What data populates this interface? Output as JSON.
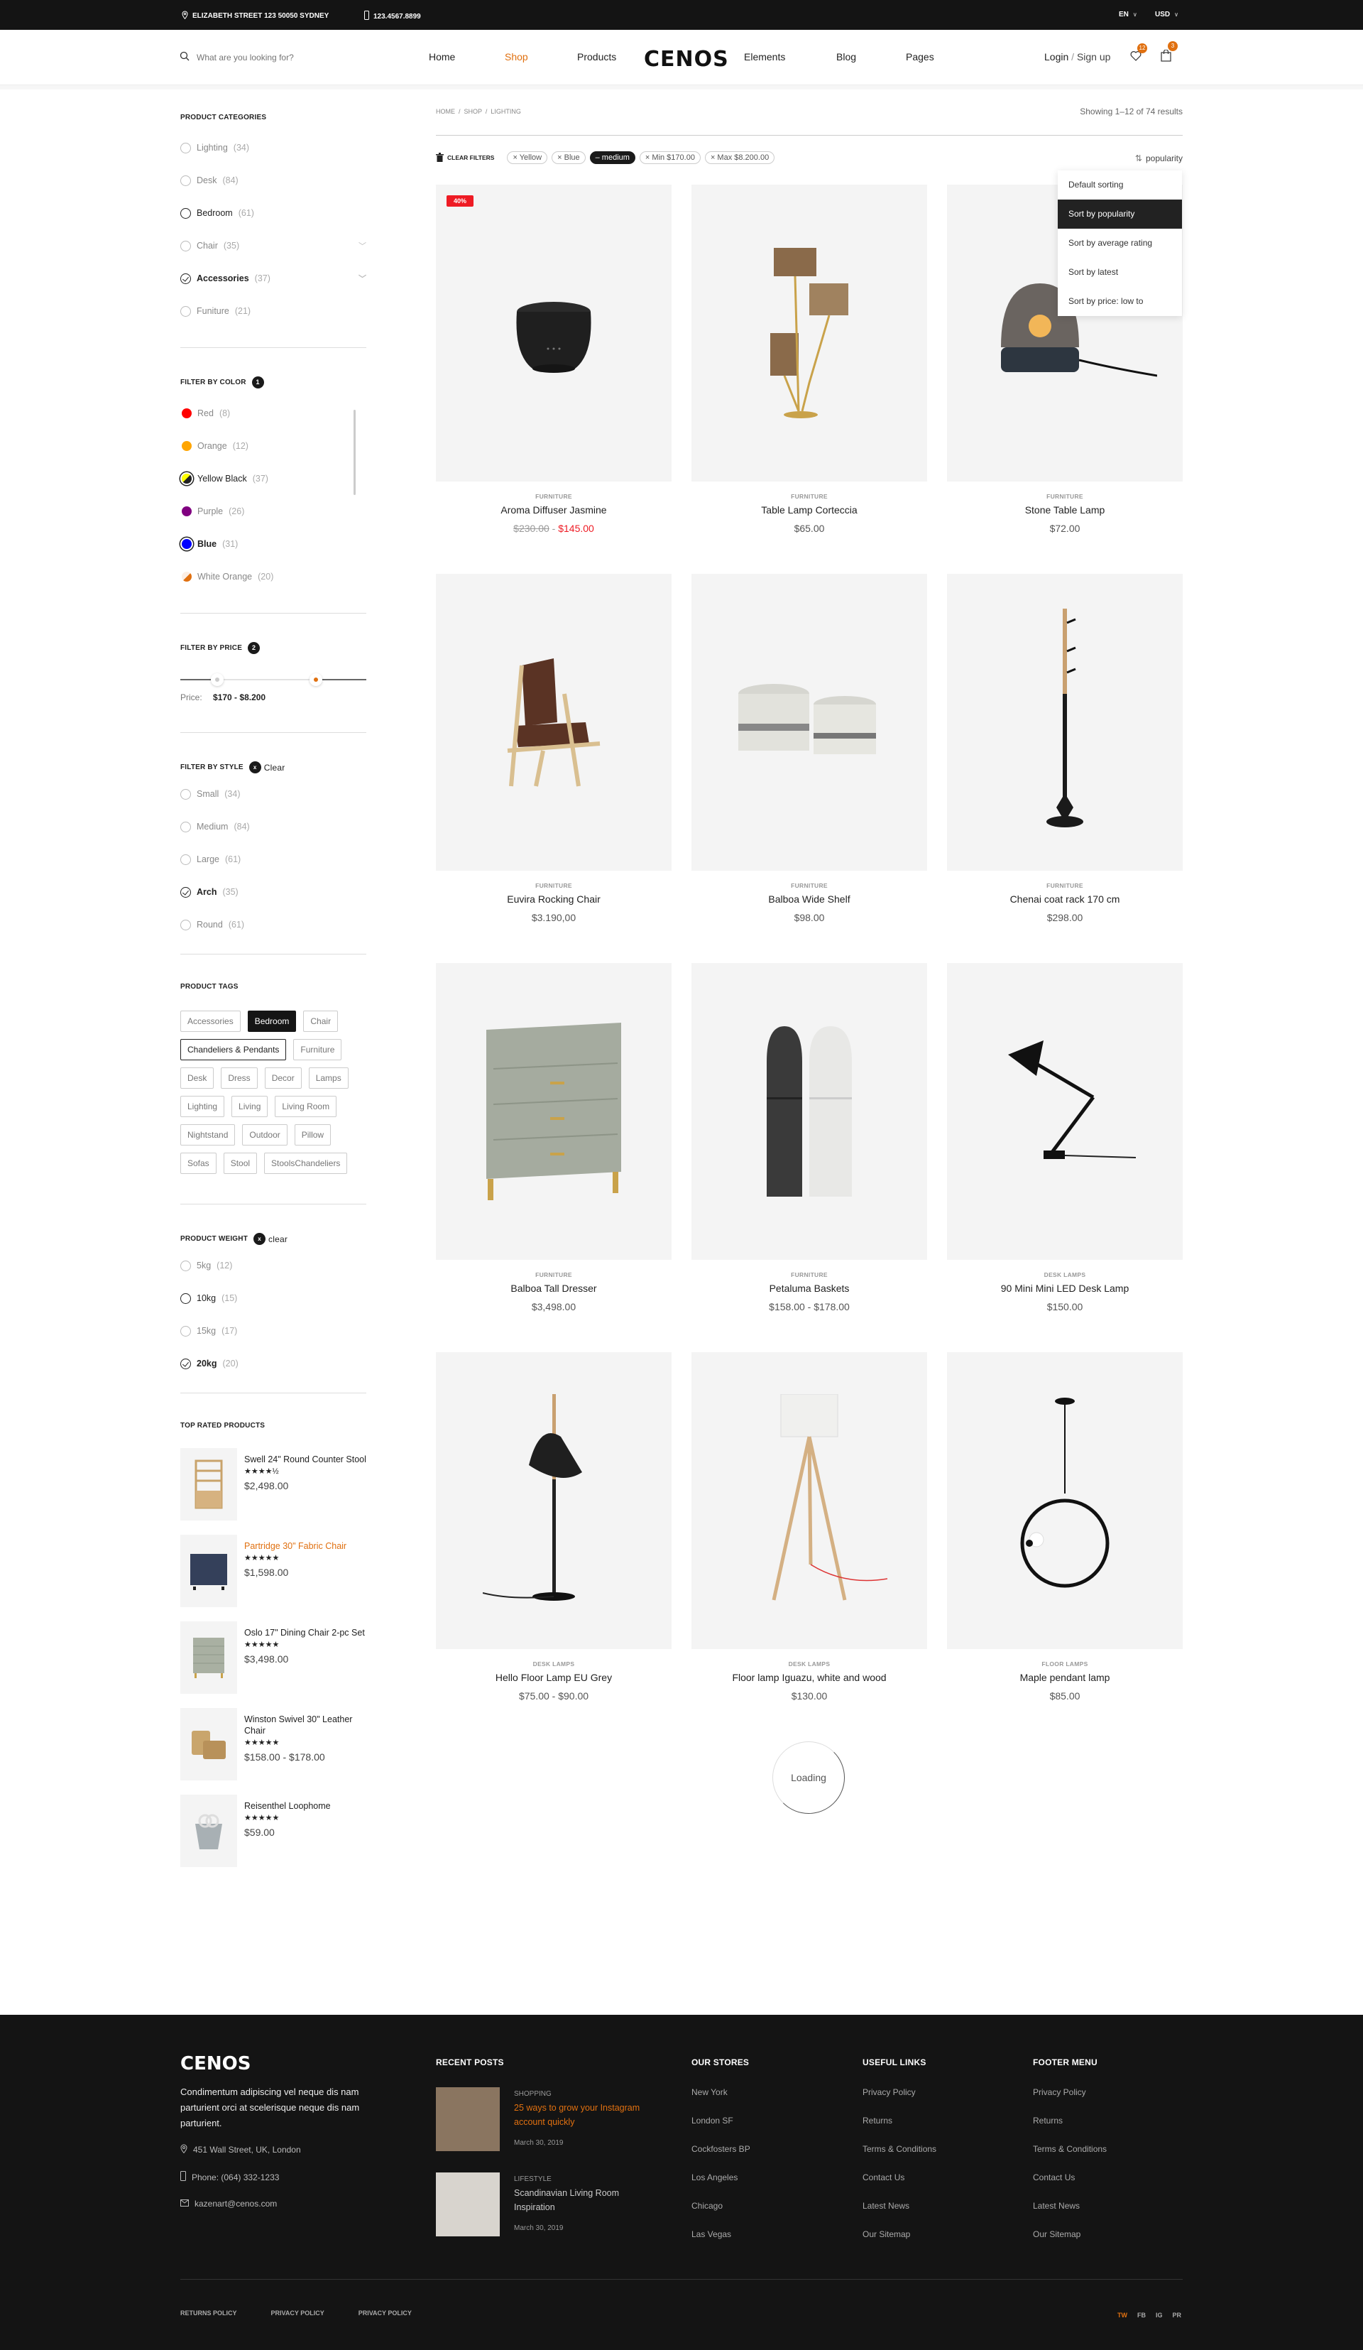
{
  "topbar": {
    "address": "ELIZABETH STREET 123 50050 SYDNEY",
    "phone": "123.4567.8899",
    "language": "EN",
    "currency": "USD"
  },
  "header": {
    "search_placeholder": "What are you looking for?",
    "nav": [
      "Home",
      "Shop",
      "Products",
      "Elements",
      "Blog",
      "Pages"
    ],
    "active_nav": "Shop",
    "logo": "CENOS",
    "login": "Login",
    "signup": "Sign up",
    "wishlist_count": "12",
    "cart_count": "3",
    "accent_color": "#e07010"
  },
  "sidebar": {
    "categories": {
      "title": "PRODUCT CATEGORIES",
      "items": [
        {
          "label": "Lighting",
          "count": "(34)",
          "state": "none"
        },
        {
          "label": "Desk",
          "count": "(84)",
          "state": "none"
        },
        {
          "label": "Bedroom",
          "count": "(61)",
          "state": "hover"
        },
        {
          "label": "Chair",
          "count": "(35)",
          "state": "none",
          "expandable": true
        },
        {
          "label": "Accessories",
          "count": "(37)",
          "state": "checked",
          "expandable": true
        },
        {
          "label": "Funiture",
          "count": "(21)",
          "state": "none"
        }
      ]
    },
    "colors": {
      "title": "FILTER BY COLOR",
      "badge": "1",
      "items": [
        {
          "label": "Red",
          "count": "(8)",
          "color": "#ff0000"
        },
        {
          "label": "Orange",
          "count": "(12)",
          "color": "#ffa500"
        },
        {
          "label": "Yellow Black",
          "count": "(37)",
          "color": "#ffff00",
          "color2": "#222222",
          "state": "hover"
        },
        {
          "label": "Purple",
          "count": "(26)",
          "color": "#800080"
        },
        {
          "label": "Blue",
          "count": "(31)",
          "color": "#0000ff",
          "state": "selected"
        },
        {
          "label": "White Orange",
          "count": "(20)",
          "color": "#fbeee4",
          "color2": "#e07010"
        }
      ]
    },
    "price": {
      "title": "FILTER BY PRICE",
      "badge": "2",
      "label": "Price:",
      "range": "$170 - $8.200",
      "min_fraction": 0.2,
      "max_fraction": 0.73
    },
    "style": {
      "title": "FILTER BY STYLE",
      "clear": "Clear",
      "items": [
        {
          "label": "Small",
          "count": "(34)",
          "state": "none"
        },
        {
          "label": "Medium",
          "count": "(84)",
          "state": "none"
        },
        {
          "label": "Large",
          "count": "(61)",
          "state": "none"
        },
        {
          "label": "Arch",
          "count": "(35)",
          "state": "checked"
        },
        {
          "label": "Round",
          "count": "(61)",
          "state": "none"
        }
      ]
    },
    "tags": {
      "title": "PRODUCT TAGS",
      "items": [
        {
          "label": "Accessories"
        },
        {
          "label": "Bedroom",
          "state": "active"
        },
        {
          "label": "Chair"
        },
        {
          "label": "Chandeliers & Pendants",
          "state": "hover"
        },
        {
          "label": "Furniture"
        },
        {
          "label": "Desk"
        },
        {
          "label": "Dress"
        },
        {
          "label": "Decor"
        },
        {
          "label": "Lamps"
        },
        {
          "label": "Lighting"
        },
        {
          "label": "Living"
        },
        {
          "label": "Living Room"
        },
        {
          "label": "Nightstand"
        },
        {
          "label": "Outdoor"
        },
        {
          "label": "Pillow"
        },
        {
          "label": "Sofas"
        },
        {
          "label": "Stool"
        },
        {
          "label": "StoolsChandeliers"
        }
      ]
    },
    "weight": {
      "title": "PRODUCT WEIGHT",
      "clear": "clear",
      "items": [
        {
          "label": "5kg",
          "count": "(12)",
          "state": "none"
        },
        {
          "label": "10kg",
          "count": "(15)",
          "state": "dark"
        },
        {
          "label": "15kg",
          "count": "(17)",
          "state": "none"
        },
        {
          "label": "20kg",
          "count": "(20)",
          "state": "checked"
        }
      ]
    },
    "top_rated": {
      "title": "TOP RATED PRODUCTS",
      "items": [
        {
          "name": "Swell 24\" Round Counter Stool",
          "stars": "★★★★½",
          "rating": 4.5,
          "price": "$2,498.00",
          "thumb": "shelf"
        },
        {
          "name": "Partridge 30\" Fabric Chair",
          "stars": "★★★★★",
          "rating": 5,
          "price": "$1,598.00",
          "thumb": "dresser-blue",
          "hover": true
        },
        {
          "name": "Oslo 17\" Dining Chair 2-pc Set",
          "stars": "★★★★★",
          "rating": 5,
          "price": "$3,498.00",
          "thumb": "dresser-grey"
        },
        {
          "name": "Winston Swivel 30\" Leather Chair",
          "stars": "★★★★★",
          "rating": 5,
          "price": "$158.00 - $178.00",
          "thumb": "baskets"
        },
        {
          "name": "Reisenthel Loophome",
          "stars": "★★★★★",
          "rating": 5,
          "price": "$59.00",
          "thumb": "bag"
        }
      ]
    }
  },
  "main": {
    "breadcrumb": [
      "HOME",
      "SHOP",
      "LIGHTING"
    ],
    "showing": "Showing 1–12 of 74 results",
    "clear_filters": "CLEAR FILTERS",
    "chips": [
      {
        "label": "× Yellow"
      },
      {
        "label": "× Blue"
      },
      {
        "label": "– medium",
        "active": true
      },
      {
        "label": "× Min $170.00"
      },
      {
        "label": "× Max $8.200.00"
      }
    ],
    "sort_label": "popularity",
    "sort_options": [
      "Default sorting",
      "Sort by popularity",
      "Sort by average rating",
      "Sort by latest",
      "Sort by price: low to"
    ],
    "sort_selected": "Sort by popularity",
    "loading": "Loading"
  },
  "products": [
    {
      "cat": "FURNITURE",
      "name": "Aroma Diffuser Jasmine",
      "old_price": "$230.00",
      "price": "$145.00",
      "sale": "40%",
      "art": "diffuser"
    },
    {
      "cat": "FURNITURE",
      "name": "Table Lamp Corteccia",
      "price": "$65.00",
      "art": "bark-lamp"
    },
    {
      "cat": "FURNITURE",
      "name": "Stone Table Lamp",
      "price": "$72.00",
      "art": "stone-lamp"
    },
    {
      "cat": "FURNITURE",
      "name": "Euvira Rocking Chair",
      "price": "$3.190,00",
      "art": "chair"
    },
    {
      "cat": "FURNITURE",
      "name": "Balboa Wide Shelf",
      "price": "$98.00",
      "art": "baskets"
    },
    {
      "cat": "FURNITURE",
      "name": "Chenai coat rack 170 cm",
      "price": "$298.00",
      "art": "coat-rack"
    },
    {
      "cat": "FURNITURE",
      "name": "Balboa Tall Dresser",
      "price": "$3,498.00",
      "art": "dresser"
    },
    {
      "cat": "FURNITURE",
      "name": "Petaluma Baskets",
      "price": "$158.00 - $178.00",
      "art": "grinders"
    },
    {
      "cat": "DESK LAMPS",
      "name": "90 Mini Mini LED Desk Lamp",
      "price": "$150.00",
      "art": "desk-lamp"
    },
    {
      "cat": "DESK LAMPS",
      "name": "Hello Floor Lamp EU Grey",
      "price": "$75.00 - $90.00",
      "art": "floor-lamp"
    },
    {
      "cat": "DESK LAMPS",
      "name": "Floor lamp Iguazu, white and wood",
      "price": "$130.00",
      "art": "tripod-lamp"
    },
    {
      "cat": "FLOOR LAMPS",
      "name": "Maple pendant lamp",
      "price": "$85.00",
      "art": "pendant"
    }
  ],
  "footer": {
    "logo": "CENOS",
    "about": "Condimentum adipiscing vel neque dis nam parturient orci at scelerisque neque dis nam parturient.",
    "address": "451 Wall Street, UK, London",
    "phone": "Phone: (064) 332-1233",
    "email": "kazenart@cenos.com",
    "recent_posts": {
      "title": "RECENT POSTS",
      "items": [
        {
          "cat": "SHOPPING",
          "title": "25 ways to grow your Instagram account quickly",
          "date": "March 30, 2019",
          "highlight": true
        },
        {
          "cat": "LIFESTYLE",
          "title": "Scandinavian Living Room Inspiration",
          "date": "March 30, 2019"
        }
      ]
    },
    "stores": {
      "title": "OUR STORES",
      "items": [
        "New York",
        "London SF",
        "Cockfosters BP",
        "Los Angeles",
        "Chicago",
        "Las Vegas"
      ]
    },
    "useful": {
      "title": "USEFUL LINKS",
      "items": [
        "Privacy Policy",
        "Returns",
        "Terms & Conditions",
        "Contact Us",
        "Latest News",
        "Our Sitemap"
      ]
    },
    "menu": {
      "title": "FOOTER MENU",
      "items": [
        "Privacy Policy",
        "Returns",
        "Terms & Conditions",
        "Contact Us",
        "Latest News",
        "Our Sitemap"
      ]
    },
    "bottom_links": [
      "RETURNS POLICY",
      "PRIVACY POLICY",
      "PRIVACY POLICY"
    ],
    "social": [
      "TW",
      "FB",
      "IG",
      "PR"
    ],
    "social_active": "TW"
  }
}
